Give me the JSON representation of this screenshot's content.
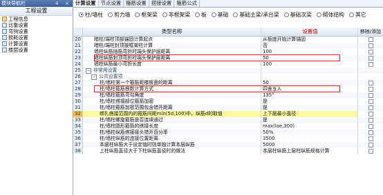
{
  "left_panel": {
    "title": "模块导航栏",
    "title_controls": [
      "4",
      "×"
    ],
    "header": "工程设置",
    "items": [
      "工程信息",
      "比重设置",
      "弯钩设置",
      "损耗设置",
      "计算设置",
      "楼层设置"
    ]
  },
  "tabs": [
    "计算设置",
    "节点设置",
    "箍筋设置",
    "搭接设置",
    "箍筋公式"
  ],
  "active_tab": 0,
  "radios": [
    "柱/墙柱",
    "剪力墙",
    "框架梁",
    "非框架梁",
    "板",
    "基础",
    "基础主梁/承台梁",
    "基础次梁",
    "砌体结构",
    "其它"
  ],
  "selected_radio": 0,
  "table": {
    "headers": [
      "类型名称",
      "设置值",
      "移除/添加"
    ],
    "rows": [
      {
        "num": "20",
        "name": "暗柱/端柱顶部锚固计算起点",
        "value": "从板底开始计算锚固",
        "kind": "lvl1"
      },
      {
        "num": "21",
        "name": "暗柱/端柱封顶按框架柱计算",
        "value": "否",
        "kind": "lvl1"
      },
      {
        "num": "22",
        "name": "墙柱纵筋插筋弯折时端头保护层距离",
        "value": "100",
        "kind": "lvl1"
      },
      {
        "num": "23",
        "name": "墙柱纵筋封顶弯折时端头保护层距离",
        "value": "50",
        "kind": "lvl1",
        "highlight": true
      },
      {
        "num": "24",
        "name": "墙柱纵筋最小弯折长度",
        "value": "100",
        "kind": "lvl1"
      },
      {
        "num": "25",
        "name": "非常用设置",
        "value": "",
        "kind": "group"
      },
      {
        "num": "26",
        "name": "公共设置项",
        "value": "",
        "kind": "group2"
      },
      {
        "num": "27",
        "name": "柱/墙柱第一个箍筋距楼板面的距离",
        "value": "50",
        "kind": "lvl2"
      },
      {
        "num": "28",
        "name": "柱/墙柱箍筋根数计算方式",
        "value": "四舍五入",
        "kind": "lvl2",
        "highlight": true
      },
      {
        "num": "29",
        "name": "柱/墙柱箍筋弯勾角度",
        "value": "135°",
        "kind": "lvl2"
      },
      {
        "num": "30",
        "name": "柱/墙柱搭接部位箍筋加密",
        "value": "是",
        "kind": "lvl2"
      },
      {
        "num": "31",
        "name": "柱/墙柱箍筋加密范围包含错开距离",
        "value": "是",
        "kind": "lvl2"
      },
      {
        "num": "32",
        "name": "绑扎搭接范围内的箍筋间距min(5d,100)中，纵筋d的取值",
        "value": "上下层最小直径",
        "kind": "lvl2",
        "selected": true
      },
      {
        "num": "33",
        "name": "柱/墙柱螺旋箍筋是否连续通过",
        "value": "是",
        "kind": "lvl2"
      },
      {
        "num": "34",
        "name": "柱/墙柱圆形箍筋的搭接长度",
        "value": "max(lae,300)",
        "kind": "lvl2"
      },
      {
        "num": "35",
        "name": "柱/墙柱纵筋搭接接头错开百分率",
        "value": "50%",
        "kind": "lvl2"
      },
      {
        "num": "36",
        "name": "柱/墙柱纵筋的连接位置距离",
        "value": "3500",
        "kind": "lvl2"
      },
      {
        "num": "37",
        "name": "本层柱纵筋大于设定值时则单独计算本层纵筋",
        "value": "5000",
        "kind": "lvl2"
      },
      {
        "num": "38",
        "name": "上柱纵筋直径大于下柱纵筋直径时的做法",
        "value": "本层柱纵筋上层柱纵筋规格计算",
        "kind": "lvl2"
      }
    ]
  },
  "colors": {
    "highlight_border": "#e02020",
    "selected_fill": "#fcfa9c",
    "header_value_text": "#c00000"
  }
}
